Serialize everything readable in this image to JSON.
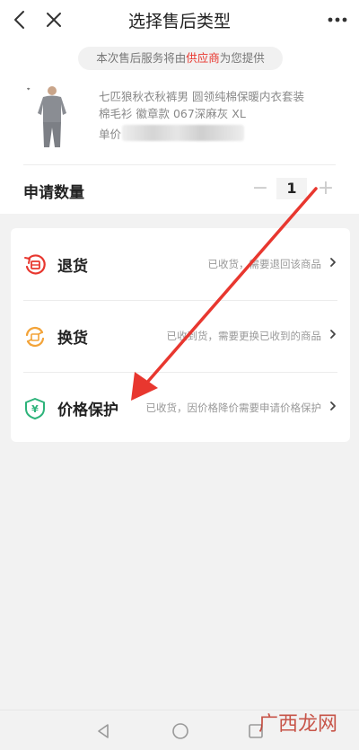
{
  "navbar": {
    "title": "选择售后类型",
    "back_icon": "chevron-left-icon",
    "close_icon": "close-icon",
    "more_icon": "more-horizontal-icon"
  },
  "notice": {
    "prefix": "本次售后服务将由",
    "highlight": "供应商",
    "suffix": "为您提供",
    "highlight_color": "#e8372f"
  },
  "product": {
    "name": "七匹狼秋衣秋裤男 圆领纯棉保暖内衣套装棉毛衫 徽章款 067深麻灰 XL",
    "price_label": "单价"
  },
  "quantity": {
    "label": "申请数量",
    "minus": "−",
    "value": "1",
    "plus": "+"
  },
  "options": [
    {
      "title": "退货",
      "desc": "已收货，需要退回该商品",
      "chevron": "›",
      "icon": "return-icon",
      "color": "#e8372f"
    },
    {
      "title": "换货",
      "desc": "已收到货，需要更换已收到的商品",
      "chevron": "›",
      "icon": "exchange-icon",
      "color": "#f3a338"
    },
    {
      "title": "价格保护",
      "desc": "已收货，因价格降价需要申请价格保护",
      "chevron": "›",
      "icon": "price-protect-icon",
      "color": "#2db37a"
    }
  ],
  "annotation": {
    "color": "#e8372f"
  },
  "watermark": {
    "text": "广西龙网"
  }
}
